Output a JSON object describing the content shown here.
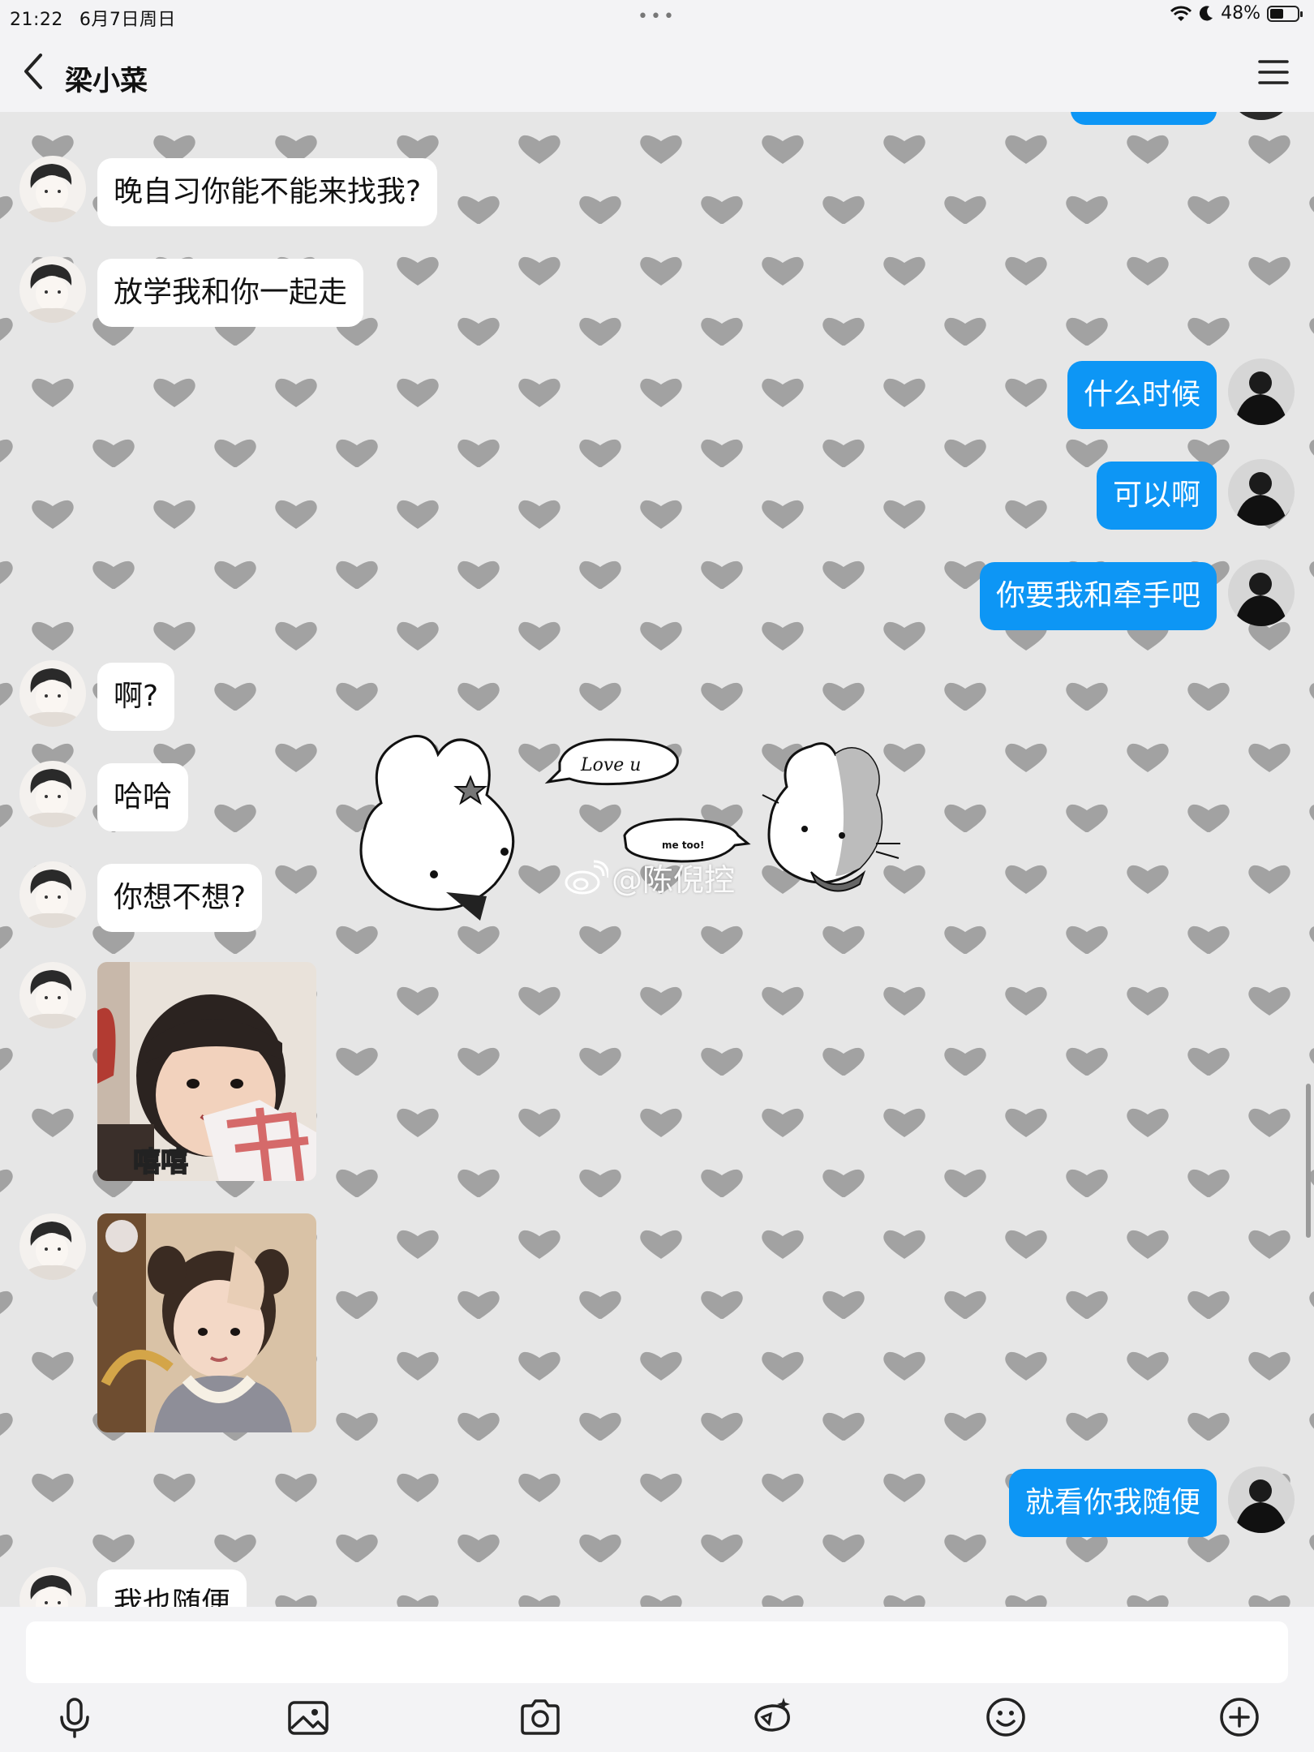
{
  "status_bar": {
    "time": "21:22",
    "date": "6月7日周日",
    "more_dots": "•••",
    "battery": "48%",
    "battery_level": 0.48
  },
  "nav": {
    "contact_name": "梁小菜",
    "back_icon": "chevron-left-icon",
    "menu_icon": "hamburger-menu-icon"
  },
  "messages": [
    {
      "side": "in",
      "text": "晚自习你能不能来找我?"
    },
    {
      "side": "in",
      "text": "放学我和你一起走"
    },
    {
      "side": "out",
      "text": "什么时候"
    },
    {
      "side": "out",
      "text": "可以啊"
    },
    {
      "side": "out",
      "text": "你要我和牵手吧"
    },
    {
      "side": "in",
      "text": "啊?"
    },
    {
      "side": "in",
      "text": "哈哈"
    },
    {
      "side": "in",
      "text": "你想不想?"
    },
    {
      "side": "in",
      "type": "image",
      "caption": "嘻嘻"
    },
    {
      "side": "in",
      "type": "image",
      "caption": ""
    },
    {
      "side": "out",
      "text": "就看你我随便"
    },
    {
      "side": "in",
      "text": "我也随便"
    }
  ],
  "sticker": {
    "bubble_left": "Love u",
    "bubble_right": "me too!"
  },
  "watermark": {
    "text": "@陈倪控",
    "icon": "weibo-icon"
  },
  "input": {
    "value": "",
    "placeholder": ""
  },
  "toolbar": {
    "icons": [
      "microphone-icon",
      "image-icon",
      "camera-icon",
      "magic-edit-icon",
      "emoji-icon",
      "plus-circle-icon"
    ]
  },
  "colors": {
    "outgoing_bubble": "#0d96f5",
    "incoming_bubble": "#ffffff",
    "wallpaper_heart": "#a2a2a2"
  }
}
